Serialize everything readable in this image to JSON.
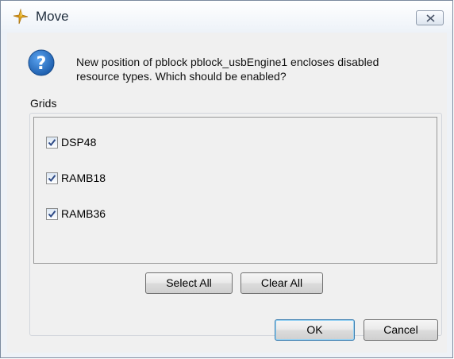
{
  "window": {
    "title": "Move"
  },
  "message": {
    "line1": "New position of pblock pblock_usbEngine1 encloses disabled",
    "line2": "resource types.  Which should be enabled?"
  },
  "grids": {
    "label": "Grids",
    "items": [
      {
        "label": "DSP48",
        "checked": true
      },
      {
        "label": "RAMB18",
        "checked": true
      },
      {
        "label": "RAMB36",
        "checked": true
      }
    ]
  },
  "buttons": {
    "select_all": "Select All",
    "clear_all": "Clear All",
    "ok": "OK",
    "cancel": "Cancel"
  },
  "colors": {
    "help_icon": "#1e5fae",
    "check_mark": "#2e4a86",
    "app_icon": "#e2a81c"
  }
}
